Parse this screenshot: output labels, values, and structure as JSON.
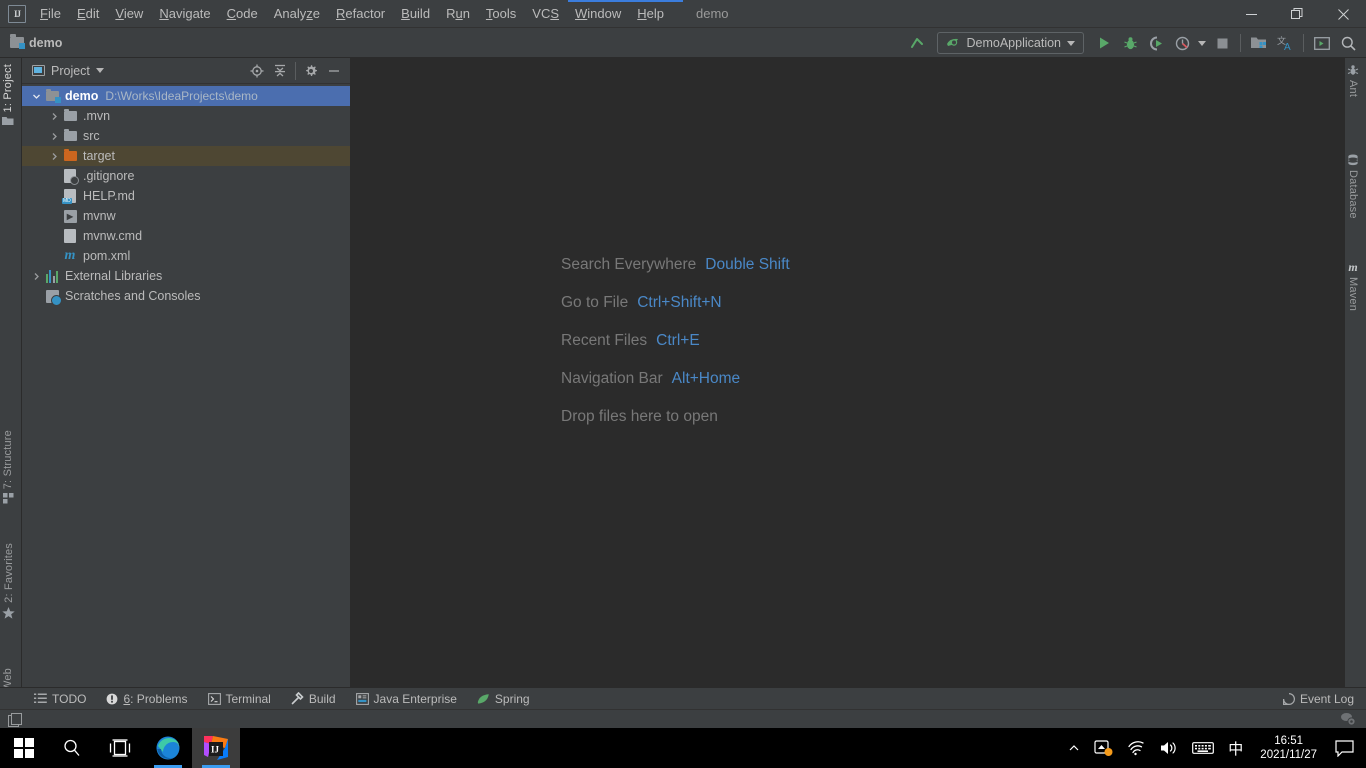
{
  "window": {
    "app_icon": "IJ",
    "title": "demo",
    "minimize_label": "—",
    "maximize_label": "❐",
    "close_label": "✕"
  },
  "menubar": {
    "items": [
      {
        "label": "File",
        "mnemonic": "F"
      },
      {
        "label": "Edit",
        "mnemonic": "E"
      },
      {
        "label": "View",
        "mnemonic": "V"
      },
      {
        "label": "Navigate",
        "mnemonic": "N"
      },
      {
        "label": "Code",
        "mnemonic": "C"
      },
      {
        "label": "Analyze",
        "mnemonic": "z"
      },
      {
        "label": "Refactor",
        "mnemonic": "R"
      },
      {
        "label": "Build",
        "mnemonic": "B"
      },
      {
        "label": "Run",
        "mnemonic": "u"
      },
      {
        "label": "Tools",
        "mnemonic": "T"
      },
      {
        "label": "VCS",
        "mnemonic": "S"
      },
      {
        "label": "Window",
        "mnemonic": "W"
      },
      {
        "label": "Help",
        "mnemonic": "H"
      }
    ]
  },
  "navbar": {
    "breadcrumb": "demo",
    "run_config": "DemoApplication",
    "buttons": [
      {
        "name": "update-project-icon",
        "glyph": "update"
      },
      {
        "name": "run-icon",
        "glyph": "run"
      },
      {
        "name": "debug-icon",
        "glyph": "debug"
      },
      {
        "name": "run-with-coverage-icon",
        "glyph": "coverage"
      },
      {
        "name": "profiler-icon",
        "glyph": "profiler"
      },
      {
        "name": "stop-icon",
        "glyph": "stop"
      },
      {
        "name": "project-structure-icon",
        "glyph": "structure"
      },
      {
        "name": "translate-icon",
        "glyph": "translate"
      },
      {
        "name": "terminal-icon",
        "glyph": "terminal"
      },
      {
        "name": "search-everywhere-icon",
        "glyph": "search"
      }
    ]
  },
  "project_panel": {
    "title": "Project",
    "actions": [
      {
        "name": "select-opened-file-icon",
        "tooltip": "Select Opened File"
      },
      {
        "name": "collapse-all-icon",
        "tooltip": "Collapse All"
      },
      {
        "name": "settings-gear-icon",
        "tooltip": "Settings"
      },
      {
        "name": "hide-panel-icon",
        "tooltip": "Hide"
      }
    ],
    "tree": [
      {
        "label": "demo",
        "path": "D:\\Works\\IdeaProjects\\demo",
        "icon": "project-folder",
        "indent": 0,
        "twisty": "expanded",
        "state": "selected",
        "bold": true
      },
      {
        "label": ".mvn",
        "path": "",
        "icon": "folder",
        "indent": 1,
        "twisty": "collapsed",
        "state": "",
        "bold": false
      },
      {
        "label": "src",
        "path": "",
        "icon": "folder",
        "indent": 1,
        "twisty": "collapsed",
        "state": "",
        "bold": false
      },
      {
        "label": "target",
        "path": "",
        "icon": "folder-orange",
        "indent": 1,
        "twisty": "collapsed",
        "state": "highlight",
        "bold": false
      },
      {
        "label": ".gitignore",
        "path": "",
        "icon": "gitignore-file",
        "indent": 1,
        "twisty": "none",
        "state": "",
        "bold": false
      },
      {
        "label": "HELP.md",
        "path": "",
        "icon": "markdown-file",
        "indent": 1,
        "twisty": "none",
        "state": "",
        "bold": false
      },
      {
        "label": "mvnw",
        "path": "",
        "icon": "shell-file",
        "indent": 1,
        "twisty": "none",
        "state": "",
        "bold": false
      },
      {
        "label": "mvnw.cmd",
        "path": "",
        "icon": "cmd-file",
        "indent": 1,
        "twisty": "none",
        "state": "",
        "bold": false
      },
      {
        "label": "pom.xml",
        "path": "",
        "icon": "maven-file",
        "indent": 1,
        "twisty": "none",
        "state": "",
        "bold": false
      },
      {
        "label": "External Libraries",
        "path": "",
        "icon": "libraries",
        "indent": 0,
        "twisty": "collapsed",
        "state": "",
        "bold": false
      },
      {
        "label": "Scratches and Consoles",
        "path": "",
        "icon": "scratches",
        "indent": 0,
        "twisty": "none",
        "state": "",
        "bold": false
      }
    ]
  },
  "editor": {
    "hints": [
      {
        "action": "Search Everywhere",
        "shortcut": "Double Shift"
      },
      {
        "action": "Go to File",
        "shortcut": "Ctrl+Shift+N"
      },
      {
        "action": "Recent Files",
        "shortcut": "Ctrl+E"
      },
      {
        "action": "Navigation Bar",
        "shortcut": "Alt+Home"
      },
      {
        "action": "Drop files here to open",
        "shortcut": ""
      }
    ]
  },
  "stripes": {
    "left_top": [
      {
        "label": "1: Project",
        "icon": "project-icon",
        "active": true
      }
    ],
    "left_bottom": [
      {
        "label": "7: Structure",
        "icon": "structure-icon",
        "active": false
      },
      {
        "label": "2: Favorites",
        "icon": "star-icon",
        "active": false
      },
      {
        "label": "Web",
        "icon": "globe-icon",
        "active": false
      }
    ],
    "right_top": [
      {
        "label": "Ant",
        "icon": "ant-icon",
        "active": false
      },
      {
        "label": "Database",
        "icon": "database-icon",
        "active": false
      },
      {
        "label": "Maven",
        "icon": "maven-icon",
        "active": false
      }
    ]
  },
  "bottom_bar": {
    "items": [
      {
        "label": "TODO",
        "icon": "todo-icon",
        "mnemonic": ""
      },
      {
        "label": "6: Problems",
        "icon": "problems-icon",
        "mnemonic": "6"
      },
      {
        "label": "Terminal",
        "icon": "terminal-icon",
        "mnemonic": ""
      },
      {
        "label": "Build",
        "icon": "build-hammer-icon",
        "mnemonic": ""
      },
      {
        "label": "Java Enterprise",
        "icon": "java-enterprise-icon",
        "mnemonic": ""
      },
      {
        "label": "Spring",
        "icon": "spring-leaf-icon",
        "mnemonic": ""
      }
    ],
    "event_log": "Event Log"
  },
  "statusbar": {
    "left_icon": "windows-stack-icon",
    "right_icon": "background-tasks-icon"
  },
  "taskbar": {
    "start": "windows-start-icon",
    "items": [
      {
        "name": "search-taskbar-icon",
        "label": ""
      },
      {
        "name": "task-view-icon",
        "label": ""
      },
      {
        "name": "microsoft-edge-icon",
        "label": ""
      },
      {
        "name": "intellij-idea-icon",
        "label": ""
      }
    ],
    "tray": [
      {
        "name": "show-hidden-icons-chevron",
        "glyph": "∧"
      },
      {
        "name": "safely-remove-hardware-icon",
        "glyph": "sd"
      },
      {
        "name": "network-wifi-icon",
        "glyph": "wifi"
      },
      {
        "name": "volume-icon",
        "glyph": "vol"
      },
      {
        "name": "keyboard-icon",
        "glyph": "kbd"
      },
      {
        "name": "ime-language-icon",
        "glyph": "中"
      }
    ],
    "clock_time": "16:51",
    "clock_date": "2021/11/27",
    "notifications": "notification-icon"
  },
  "colors": {
    "chrome": "#3c3f41",
    "editor_bg": "#2b2b2b",
    "selection": "#4b6eaf",
    "highlight": "#4e4733",
    "accent_blue": "#4a88c7",
    "text": "#bbbbbb",
    "muted": "#787878",
    "green_run": "#59a869",
    "orange_folder": "#cc661f",
    "taskbar": "#000000"
  }
}
